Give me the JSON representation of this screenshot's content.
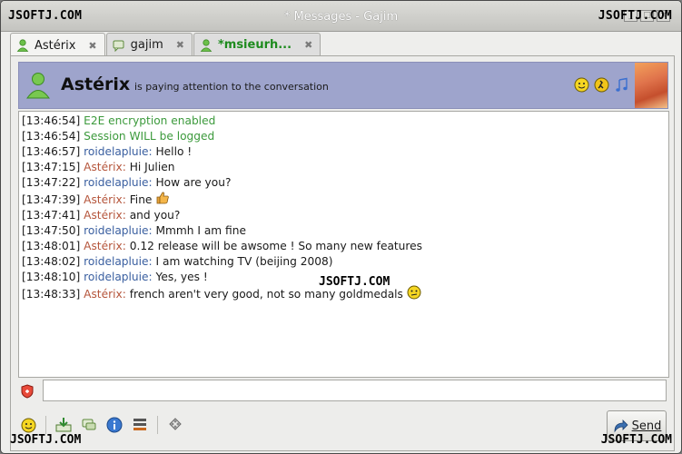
{
  "watermark": "JSOFTJ.COM",
  "window": {
    "title": "* Messages - Gajim"
  },
  "tabs": [
    {
      "label": "Astérix",
      "icon": "online-user-icon",
      "state": "active"
    },
    {
      "label": "gajim",
      "icon": "chat-icon",
      "state": "normal"
    },
    {
      "label": "*msieurh...",
      "icon": "online-user-icon",
      "state": "unread"
    }
  ],
  "banner": {
    "name": "Astérix",
    "status": "is paying attention to the conversation",
    "icons": [
      "mood-smiley-icon",
      "activity-icon",
      "music-note-icon"
    ]
  },
  "messages": [
    {
      "time": "[13:46:54]",
      "text": "E2E encryption enabled",
      "kind": "sys"
    },
    {
      "time": "[13:46:54]",
      "text": "Session WILL be logged",
      "kind": "sys"
    },
    {
      "time": "[13:46:57]",
      "nick": "roidelapluie:",
      "text": "Hello !",
      "kind": "me"
    },
    {
      "time": "[13:47:15]",
      "nick": "Astérix:",
      "text": "Hi Julien",
      "kind": "them"
    },
    {
      "time": "[13:47:22]",
      "nick": "roidelapluie:",
      "text": "How are you?",
      "kind": "me"
    },
    {
      "time": "[13:47:39]",
      "nick": "Astérix:",
      "text": "Fine",
      "kind": "them",
      "emoticon": "thumbs-up-icon"
    },
    {
      "time": "[13:47:41]",
      "nick": "Astérix:",
      "text": "and you?",
      "kind": "them"
    },
    {
      "time": "[13:47:50]",
      "nick": "roidelapluie:",
      "text": "Mmmh I am fine",
      "kind": "me"
    },
    {
      "time": "[13:48:01]",
      "nick": "Astérix:",
      "text": "0.12 release will be awsome ! So many new features",
      "kind": "them"
    },
    {
      "time": "[13:48:02]",
      "nick": "roidelapluie:",
      "text": "I am watching TV (beijing 2008)",
      "kind": "me"
    },
    {
      "time": "[13:48:10]",
      "nick": "roidelapluie:",
      "text": "Yes, yes !",
      "kind": "me"
    },
    {
      "time": "[13:48:33]",
      "nick": "Astérix:",
      "text": "french aren't very good, not so many goldmedals",
      "kind": "them",
      "emoticon": "confused-smiley-icon"
    }
  ],
  "input": {
    "value": ""
  },
  "toolbar_icons": [
    "emoticons-icon",
    "send-file-icon",
    "conversation-icon",
    "info-icon",
    "history-icon",
    "actions-icon"
  ],
  "send_button": {
    "label": "Send"
  },
  "colors": {
    "banner": "#9ea4cc",
    "system": "#3c9a3c",
    "contact": "#b5553b",
    "self": "#3a5fa0"
  }
}
